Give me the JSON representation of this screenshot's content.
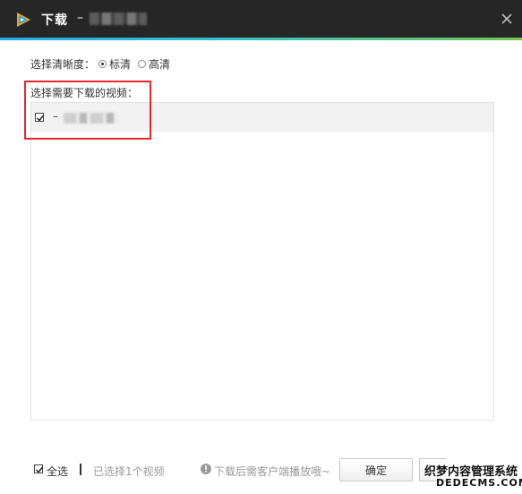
{
  "window": {
    "title": "下载",
    "title_separator": "–",
    "logo_icon": "tencent-video-logo",
    "close_icon": "close-icon",
    "accent_colors": [
      "#25a9e8",
      "#73c84f"
    ]
  },
  "resolution": {
    "label": "选择清晰度：",
    "options": [
      {
        "label": "标清",
        "selected": true
      },
      {
        "label": "高清",
        "selected": false
      }
    ]
  },
  "video_list": {
    "label": "选择需要下载的视频：",
    "items": [
      {
        "prefix": "–",
        "checked": true
      }
    ]
  },
  "footer": {
    "select_all_label": "全选",
    "select_all_checked": true,
    "selected_count": "已选择1个视频",
    "hint": "下载后需客户端播放哦~",
    "ok_label": "确定"
  },
  "watermark": {
    "line1": "织梦内容管理系统",
    "line2": "DEDECMS.COM"
  }
}
